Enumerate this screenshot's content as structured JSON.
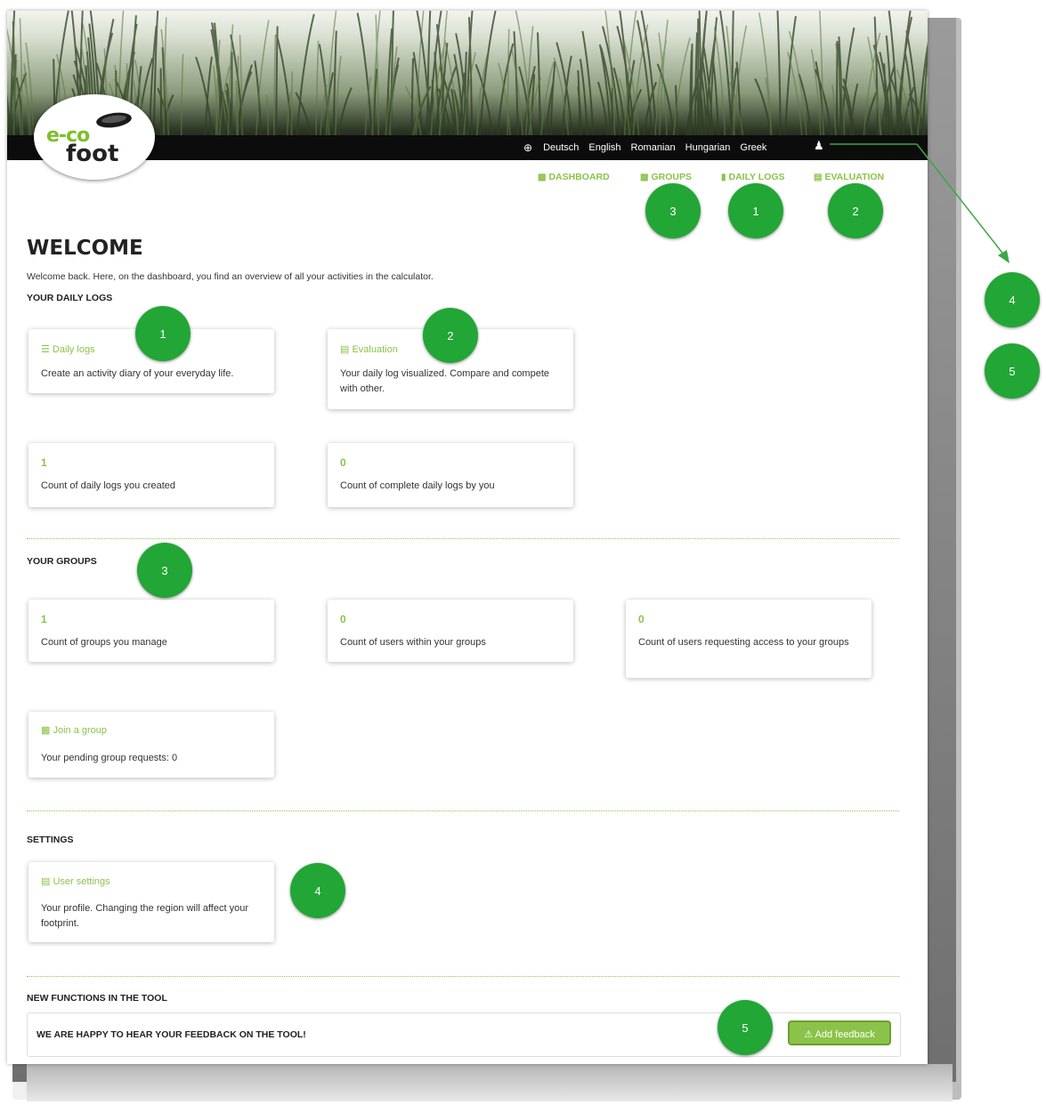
{
  "logo": {
    "line1": "e-co",
    "line2": "foot"
  },
  "languages": [
    "Deutsch",
    "English",
    "Romanian",
    "Hungarian",
    "Greek"
  ],
  "nav": {
    "dashboard": "DASHBOARD",
    "groups": "GROUPS",
    "daily_logs": "DAILY LOGS",
    "evaluation": "EVALUATION"
  },
  "welcome": {
    "title": "WELCOME",
    "text": "Welcome back. Here, on the dashboard, you find an overview of all your activities in the calculator."
  },
  "daily_logs_section": {
    "title": "YOUR DAILY LOGS",
    "cards": [
      {
        "title": "Daily logs",
        "desc": "Create an activity diary of your everyday life."
      },
      {
        "title": "Evaluation",
        "desc": "Your daily log visualized. Compare and compete with other."
      }
    ],
    "stats": [
      {
        "value": "1",
        "label": "Count of daily logs you created"
      },
      {
        "value": "0",
        "label": "Count of complete daily logs by you"
      }
    ]
  },
  "groups_section": {
    "title": "YOUR GROUPS",
    "stats": [
      {
        "value": "1",
        "label": "Count of groups you manage"
      },
      {
        "value": "0",
        "label": "Count of users within your groups"
      },
      {
        "value": "0",
        "label": "Count of users requesting access to your groups"
      }
    ],
    "join": {
      "title": "Join a group",
      "desc": "Your pending group requests: 0"
    }
  },
  "settings_section": {
    "title": "SETTINGS",
    "card": {
      "title": "User settings",
      "desc": "Your profile. Changing the region will affect your footprint."
    }
  },
  "new_functions": {
    "title": "NEW FUNCTIONS IN THE TOOL",
    "text": "WE ARE HAPPY TO HEAR YOUR FEEDBACK ON THE TOOL!",
    "button": "Add feedback"
  },
  "badges": {
    "nav_groups": "3",
    "nav_daily_logs": "1",
    "nav_evaluation": "2",
    "side_1": "4",
    "side_2": "5",
    "card_daily_logs": "1",
    "card_evaluation": "2",
    "groups_title": "3",
    "settings": "4",
    "feedback": "5"
  },
  "colors": {
    "accent": "#8bc34a",
    "badge": "#22a636",
    "header_bar": "#0c0c0c"
  },
  "icons": [
    "globe-icon",
    "user-icon",
    "dashboard-icon",
    "groups-icon",
    "daily-logs-icon",
    "evaluation-icon",
    "list-icon",
    "chart-icon",
    "warning-icon"
  ]
}
